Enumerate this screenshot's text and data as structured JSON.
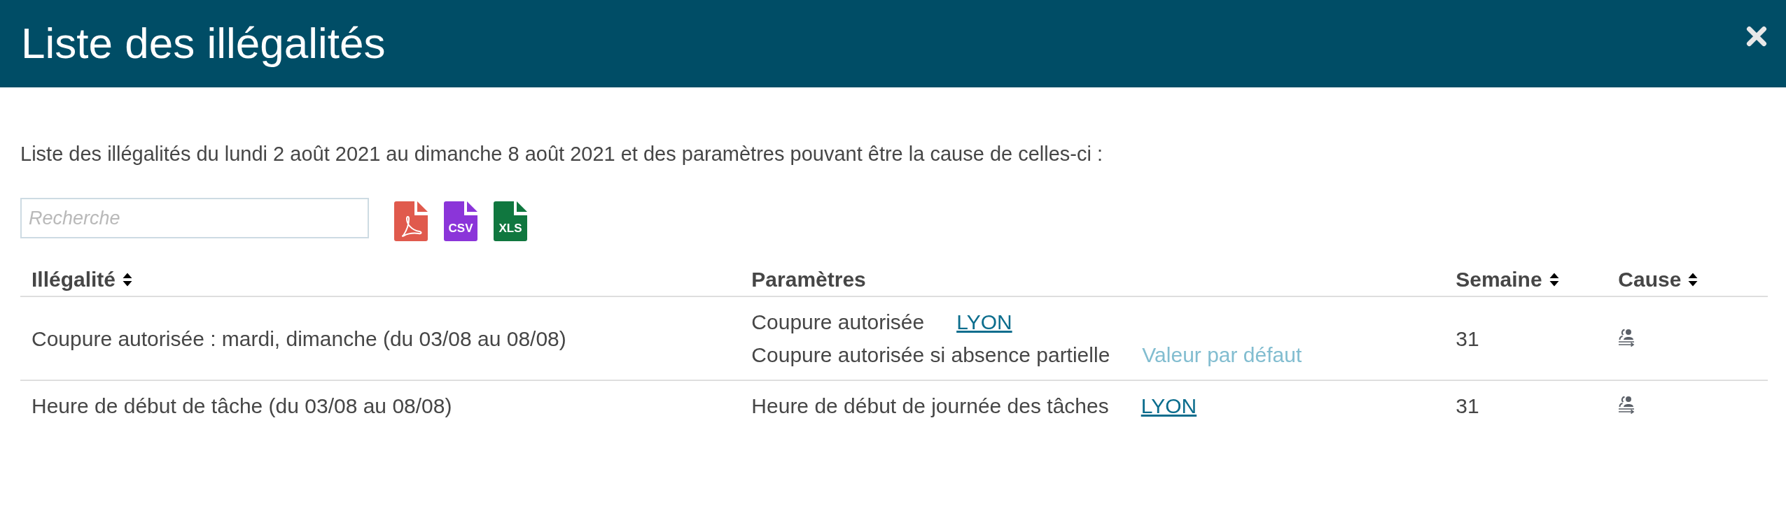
{
  "window": {
    "title": "Liste des illégalités"
  },
  "description": "Liste des illégalités du lundi 2 août 2021 au dimanche 8 août 2021 et des paramètres pouvant être la cause de celles-ci :",
  "search": {
    "placeholder": "Recherche"
  },
  "exports": [
    {
      "kind": "pdf",
      "color": "#e05a4d"
    },
    {
      "kind": "csv",
      "label": "CSV",
      "color": "#8b35d9"
    },
    {
      "kind": "xls",
      "label": "XLS",
      "color": "#10773f"
    }
  ],
  "table": {
    "columns": [
      {
        "label": "Illégalité",
        "sortable": true
      },
      {
        "label": "Paramètres",
        "sortable": false
      },
      {
        "label": "Semaine",
        "sortable": true
      },
      {
        "label": "Cause",
        "sortable": true
      }
    ],
    "rows": [
      {
        "illegality": "Coupure autorisée : mardi, dimanche (du 03/08 au 08/08)",
        "parameters": [
          {
            "name": "Coupure autorisée",
            "value": "LYON",
            "kind": "link"
          },
          {
            "name": "Coupure autorisée si absence partielle",
            "value": "Valeur par défaut",
            "kind": "default"
          }
        ],
        "week": "31"
      },
      {
        "illegality": "Heure de début de tâche (du 03/08 au 08/08)",
        "parameters": [
          {
            "name": "Heure de début de journée des tâches",
            "value": "LYON",
            "kind": "link"
          }
        ],
        "week": "31"
      }
    ]
  }
}
